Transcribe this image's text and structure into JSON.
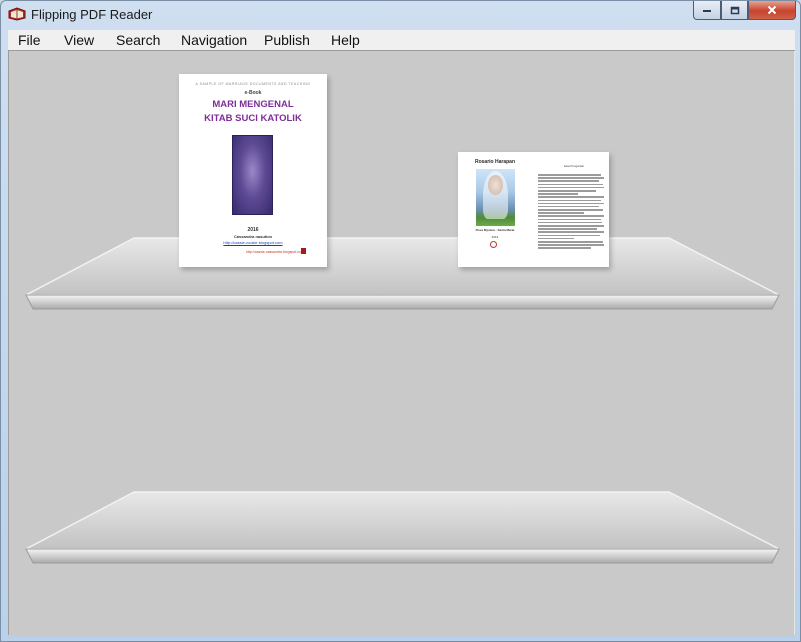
{
  "window": {
    "title": "Flipping PDF Reader",
    "icons": {
      "app": "book-icon",
      "minimize": "minimize-icon",
      "maximize": "maximize-icon",
      "close": "close-icon"
    }
  },
  "menu": {
    "items": [
      "File",
      "View",
      "Search",
      "Navigation",
      "Publish",
      "Help"
    ]
  },
  "books": [
    {
      "header": "A SAMPLE OF MARRIAGE DOCUMENTS AND TEACHING",
      "label": "e-Book",
      "title_line1": "MARI MENGENAL",
      "title_line2": "KITAB SUCI KATOLIK",
      "year": "2016",
      "author": "Cassandra nasution",
      "link": "http://cassie-cookie.blogspot.com",
      "footer_link": "http://cassie-cassandra.blogspot.com"
    },
    {
      "title": "Rosario Harapan",
      "right_title": "kata Pengantar",
      "caption": "Rosa Mystica - Santa Maria",
      "year": "2014"
    }
  ],
  "colors": {
    "accent": "#7d2e98",
    "shelf_bg": "#c9c9c9",
    "titlebar": "#c4d7ec"
  }
}
